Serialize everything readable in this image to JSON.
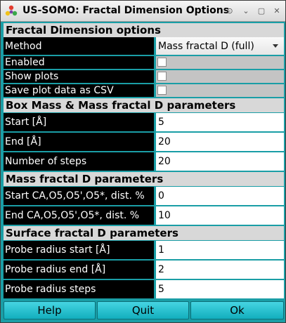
{
  "window": {
    "title": "US-SOMO: Fractal Dimension Options",
    "buttons": {
      "up": "⊙",
      "minimize": "⌄",
      "maximize": "▢",
      "close": "✕"
    }
  },
  "sections": {
    "fractal_options": "Fractal Dimension options",
    "box_mass": "Box Mass & Mass fractal D parameters",
    "mass_fractal": "Mass fractal D parameters",
    "surface_fractal": "Surface fractal D parameters"
  },
  "fields": {
    "method": {
      "label": "Method",
      "value": "Mass fractal D (full)"
    },
    "enabled": {
      "label": "Enabled",
      "checked": false
    },
    "show_plots": {
      "label": "Show plots",
      "checked": false
    },
    "save_csv": {
      "label": "Save plot data as CSV",
      "checked": false
    },
    "start": {
      "label": "Start [Å]",
      "value": "5"
    },
    "end": {
      "label": "End [Å]",
      "value": "20"
    },
    "steps": {
      "label": "Number of steps",
      "value": "20"
    },
    "start_dist": {
      "label": "Start CA,O5,O5',O5*, dist. %",
      "value": "0"
    },
    "end_dist": {
      "label": "End CA,O5,O5',O5*, dist. %",
      "value": "10"
    },
    "probe_start": {
      "label": "Probe radius start [Å]",
      "value": "1"
    },
    "probe_end": {
      "label": "Probe radius end [Å]",
      "value": "2"
    },
    "probe_steps": {
      "label": "Probe radius steps",
      "value": "5"
    }
  },
  "actions": {
    "help": "Help",
    "quit": "Quit",
    "ok": "Ok"
  },
  "colors": {
    "background": "#1a9ea6",
    "label_bg": "#000000",
    "section_bg": "#d8d8d8",
    "button": "#2cc3d0"
  },
  "icons": {
    "app": "us-somo-logo-icon"
  }
}
